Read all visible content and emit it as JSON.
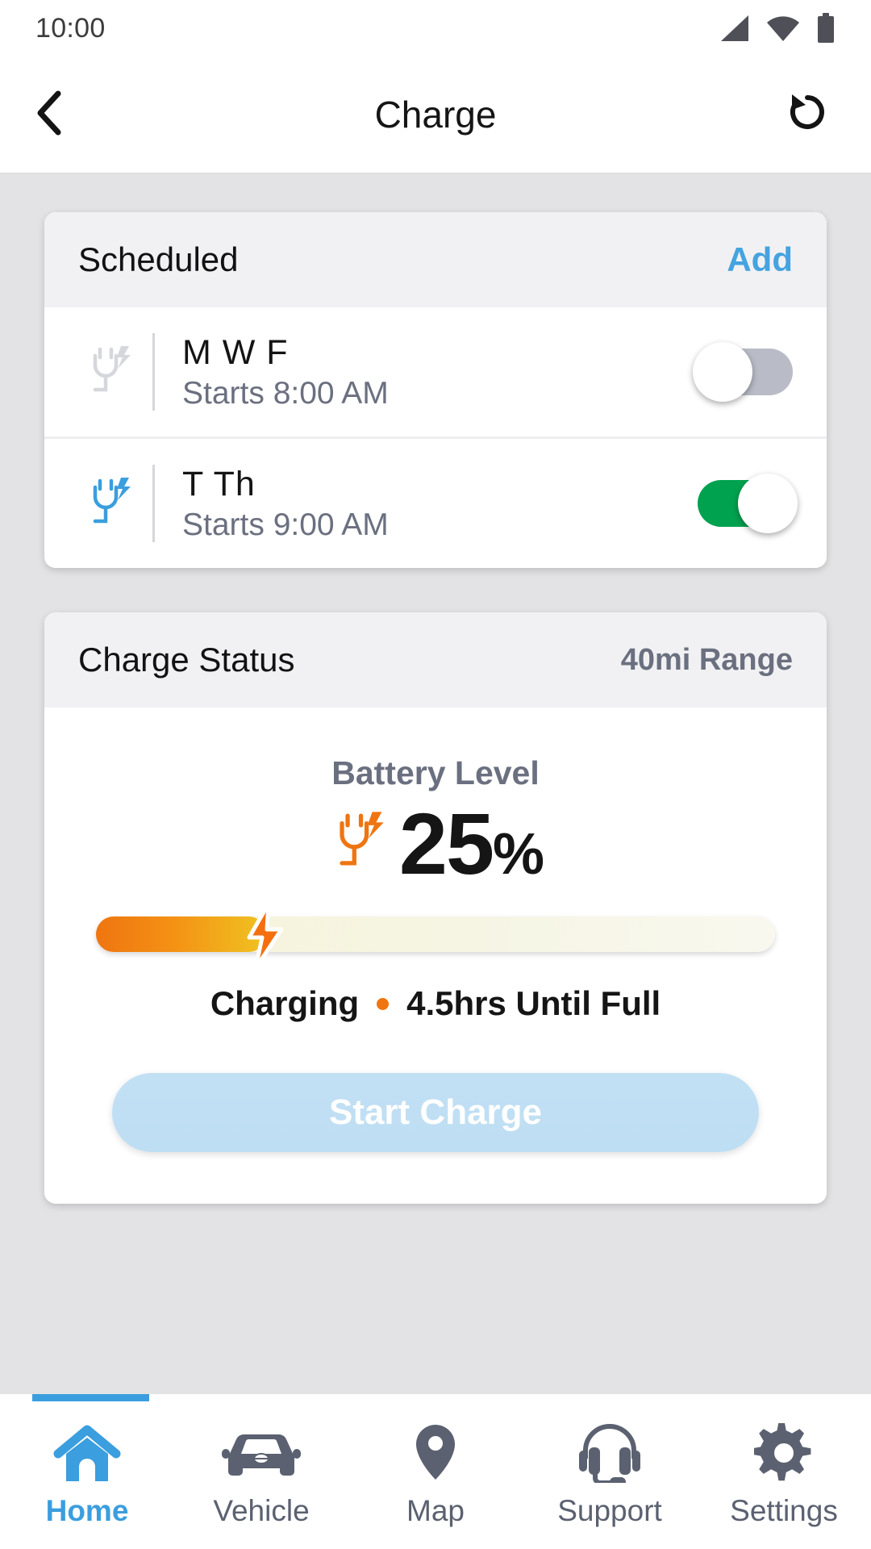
{
  "status_bar": {
    "time": "10:00",
    "icons": [
      "signal-icon",
      "wifi-icon",
      "battery-icon"
    ]
  },
  "app_bar": {
    "back_icon": "chevron-left-icon",
    "title": "Charge",
    "refresh_icon": "refresh-icon"
  },
  "scheduled_card": {
    "title": "Scheduled",
    "add_label": "Add",
    "rows": [
      {
        "icon": "plug-charge-icon",
        "icon_color": "#d5d7dc",
        "days": "M W F",
        "time": "Starts 8:00 AM",
        "enabled": false
      },
      {
        "icon": "plug-charge-icon",
        "icon_color": "#3b9ede",
        "days": "T Th",
        "time": "Starts 9:00 AM",
        "enabled": true
      }
    ]
  },
  "charge_status_card": {
    "title": "Charge Status",
    "range": "40mi Range",
    "battery_label": "Battery Level",
    "plug_icon": "plug-charge-icon",
    "battery_value": "25",
    "battery_symbol": "%",
    "battery_percent": 25,
    "progress_fill_color": "#ef7511",
    "progress_track_color": "#f6f5e4",
    "bolt_icon": "lightning-bolt-icon",
    "state_label": "Charging",
    "time_remaining": "4.5hrs Until Full",
    "separator_color": "#ef7511",
    "start_button_label": "Start Charge",
    "start_button_color": "#c2e0f4"
  },
  "bottom_nav": {
    "active_index": 0,
    "accent_color": "#3b9ede",
    "items": [
      {
        "icon": "home-icon",
        "label": "Home"
      },
      {
        "icon": "car-icon",
        "label": "Vehicle"
      },
      {
        "icon": "map-pin-icon",
        "label": "Map"
      },
      {
        "icon": "headset-icon",
        "label": "Support"
      },
      {
        "icon": "gear-icon",
        "label": "Settings"
      }
    ]
  }
}
